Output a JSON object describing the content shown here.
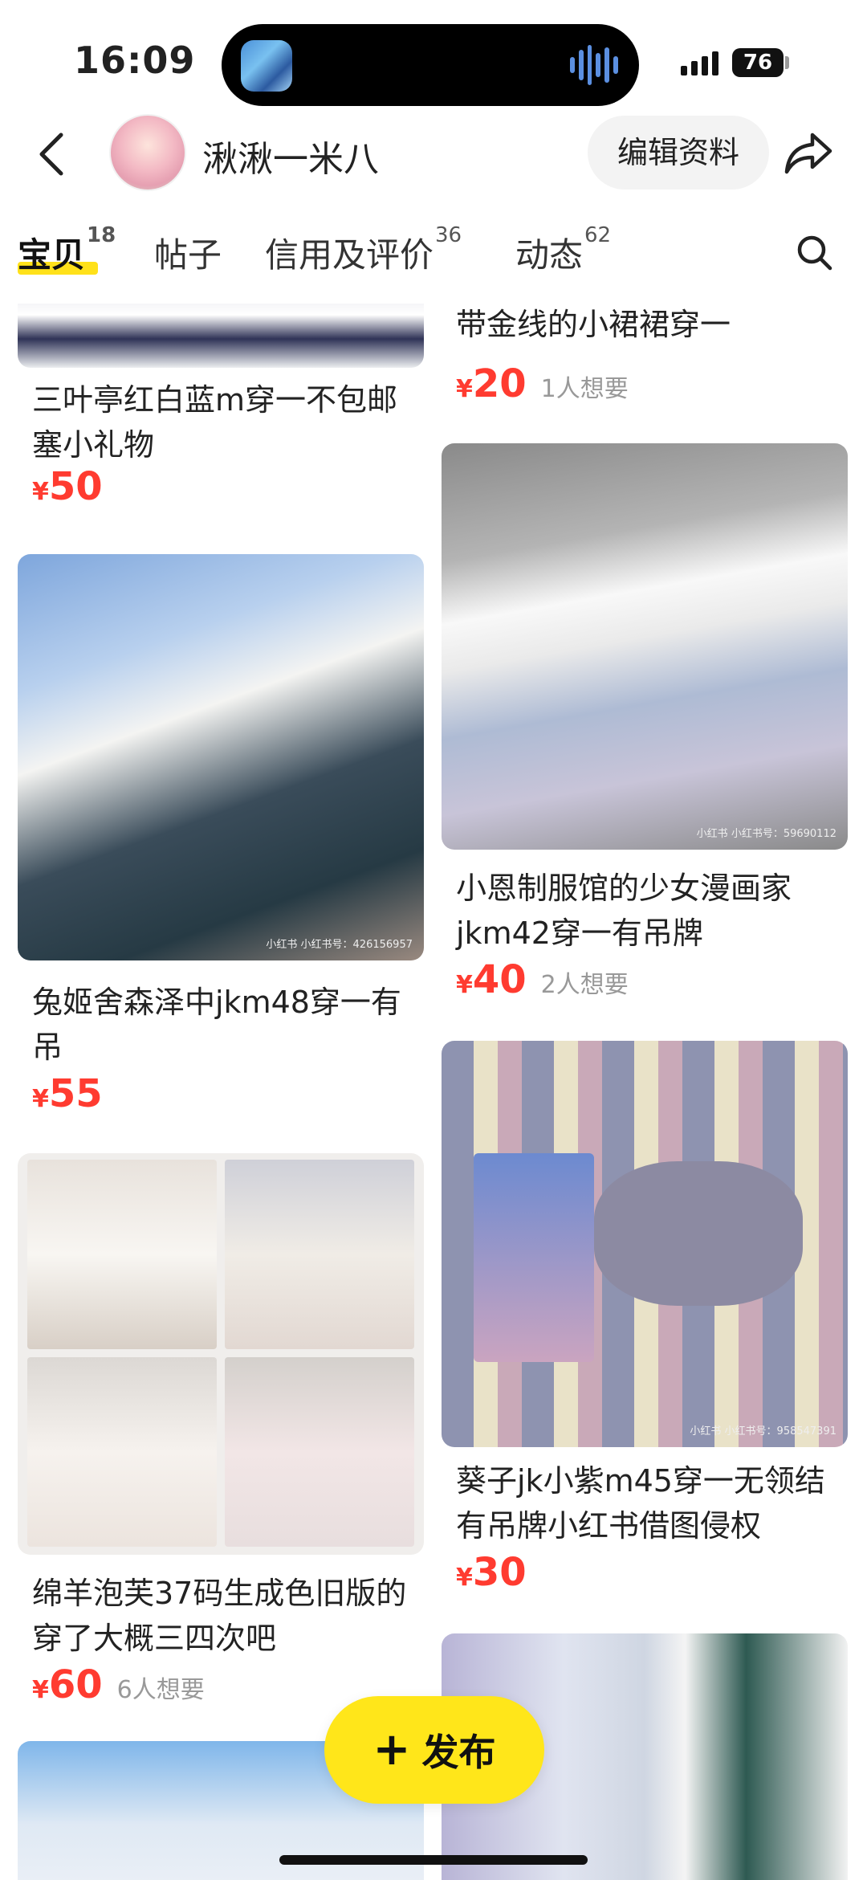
{
  "status_bar": {
    "time": "16:09",
    "battery": "76"
  },
  "header": {
    "username": "湫湫一米八",
    "edit_button": "编辑资料"
  },
  "tabs": [
    {
      "label": "宝贝",
      "count": "18"
    },
    {
      "label": "帖子",
      "count": ""
    },
    {
      "label": "信用及评价",
      "count": "36"
    },
    {
      "label": "动态",
      "count": "62"
    }
  ],
  "left_items": [
    {
      "title": "三叶亭红白蓝m穿一不包邮塞小礼物",
      "yen": "¥",
      "price": "50",
      "wants": ""
    },
    {
      "title": "兔姬舍森泽中jkm48穿一有吊",
      "yen": "¥",
      "price": "55",
      "wants": "",
      "watermark_tag": "小红书",
      "watermark_id": "小红书号：426156957"
    },
    {
      "title": "绵羊泡芙37码生成色旧版的穿了大概三四次吧",
      "yen": "¥",
      "price": "60",
      "wants": "6人想要"
    }
  ],
  "right_items": [
    {
      "title": "带金线的小裙裙穿一",
      "yen": "¥",
      "price": "20",
      "wants": "1人想要"
    },
    {
      "title": "小恩制服馆的少女漫画家jkm42穿一有吊牌",
      "yen": "¥",
      "price": "40",
      "wants": "2人想要",
      "watermark_tag": "小红书",
      "watermark_id": "小红书号：59690112"
    },
    {
      "title": "葵子jk小紫m45穿一无领结有吊牌小红书借图侵权",
      "yen": "¥",
      "price": "30",
      "wants": "",
      "watermark_tag": "小红书",
      "watermark_id": "小红书号：958547391"
    }
  ],
  "post_button": {
    "label": "发布"
  }
}
